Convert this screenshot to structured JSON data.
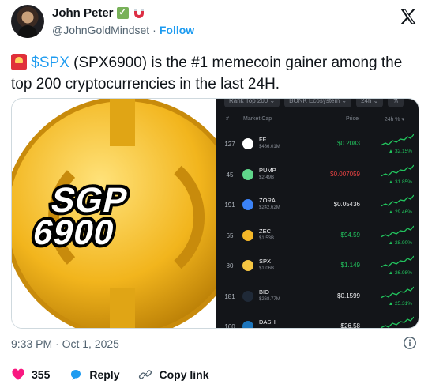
{
  "author": {
    "name": "John Peter",
    "badges": [
      "check-mark-icon",
      "magnet-icon"
    ],
    "handle": "@JohnGoldMindset",
    "separator": "·",
    "follow_label": "Follow"
  },
  "tweet": {
    "cashtag": "$SPX",
    "text": " (SPX6900) is the #1 memecoin gainer among the top 200 cryptocurrencies in the last 24H."
  },
  "media": {
    "coin_text_line1": "SGP",
    "coin_text_line2": "6900",
    "filters": [
      "Rank  Top 200 ⌄",
      "BONK Ecosystem ⌄",
      "24h ⌄",
      "⚗"
    ],
    "columns": {
      "hash": "#",
      "market_cap": "Market Cap",
      "price": "Price",
      "change": "24h % ▾"
    },
    "rows": [
      {
        "rank": "127",
        "symbol": "FF",
        "mcap": "$486.01M",
        "price": "$0.2083",
        "price_color": "#22c55e",
        "change": "▲ 32.15%",
        "icon_color": "#ffffff"
      },
      {
        "rank": "45",
        "symbol": "PUMP",
        "mcap": "$2.49B",
        "price": "$0.007059",
        "price_color": "#ef4444",
        "change": "▲ 31.85%",
        "icon_color": "#5fd68a"
      },
      {
        "rank": "191",
        "symbol": "ZORA",
        "mcap": "$242.62M",
        "price": "$0.05436",
        "price_color": "#f2f3f5",
        "change": "▲ 29.46%",
        "icon_color": "#3b82f6"
      },
      {
        "rank": "65",
        "symbol": "ZEC",
        "mcap": "$1.53B",
        "price": "$94.59",
        "price_color": "#22c55e",
        "change": "▲ 28.90%",
        "icon_color": "#f4b728"
      },
      {
        "rank": "80",
        "symbol": "SPX",
        "mcap": "$1.06B",
        "price": "$1.149",
        "price_color": "#22c55e",
        "change": "▲ 26.98%",
        "icon_color": "#f5c542"
      },
      {
        "rank": "181",
        "symbol": "BIO",
        "mcap": "$268.77M",
        "price": "$0.1599",
        "price_color": "#f2f3f5",
        "change": "▲ 25.31%",
        "icon_color": "#1f2937"
      },
      {
        "rank": "160",
        "symbol": "DASH",
        "mcap": "",
        "price": "$26.58",
        "price_color": "#f2f3f5",
        "change": "",
        "icon_color": "#1c75bc"
      }
    ]
  },
  "meta": {
    "timestamp": "9:33 PM · Oct 1, 2025"
  },
  "actions": {
    "likes_count": "355",
    "reply_label": "Reply",
    "copy_link_label": "Copy link"
  },
  "colors": {
    "accent": "#1d9bf0",
    "like": "#f91880",
    "up": "#22c55e",
    "down": "#ef4444"
  }
}
